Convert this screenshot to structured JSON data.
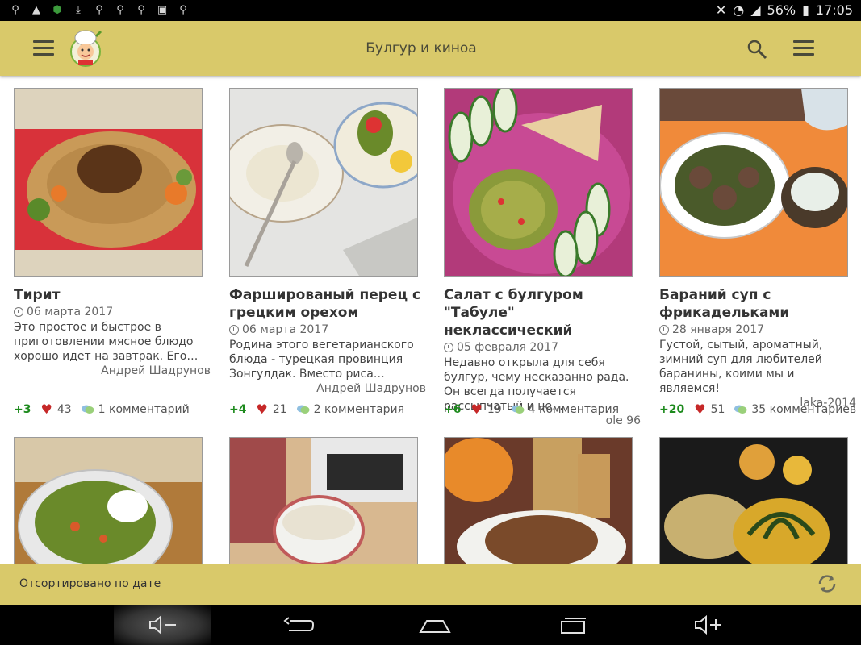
{
  "status_bar": {
    "battery": "56%",
    "time": "17:05"
  },
  "app_bar": {
    "title": "Булгур и киноа"
  },
  "cards": [
    {
      "title": "Тирит",
      "date": "06 марта 2017",
      "description": "Это простое и быстрое в приготовлении мясное блюдо хорошо идет на завтрак. Его…",
      "author": "Андрей Шадрунов",
      "votes": "+3",
      "likes": "43",
      "comments": "1 комментарий"
    },
    {
      "title": "Фаршированый перец с грецким орехом",
      "date": "06 марта 2017",
      "description": "Родина этого вегетарианского блюда - турецкая провинция Зонгулдак. Вместо риса…",
      "author": "Андрей Шадрунов",
      "votes": "+4",
      "likes": "21",
      "comments": "2 комментария"
    },
    {
      "title": "Салат с булгуром \"Табуле\" неклассический",
      "date": "05 февраля 2017",
      "description": "Недавно открыла для себя булгур, чему несказанно рада. Он всегда получается рассыпчатый и не…",
      "author": "ole 96",
      "votes": "+6",
      "likes": "19",
      "comments": "4 комментария"
    },
    {
      "title": "Бараний суп с фрикадельками",
      "date": "28 января 2017",
      "description": "Густой, сытый, ароматный, зимний суп для любителей баранины, коими мы и являемся!",
      "author": "laka-2014",
      "votes": "+20",
      "likes": "51",
      "comments": "35 комментариев"
    }
  ],
  "sort_bar": {
    "label": "Отсортировано по дате"
  },
  "icons": {
    "menu": "hamburger-icon",
    "search": "search-icon",
    "overflow": "menu-icon",
    "refresh": "refresh-icon",
    "heart": "heart-icon",
    "comments": "comment-icon",
    "clock": "clock-icon"
  },
  "colors": {
    "accent": "#d9c96a",
    "votes": "#1d8a1d",
    "heart": "#c62828"
  }
}
